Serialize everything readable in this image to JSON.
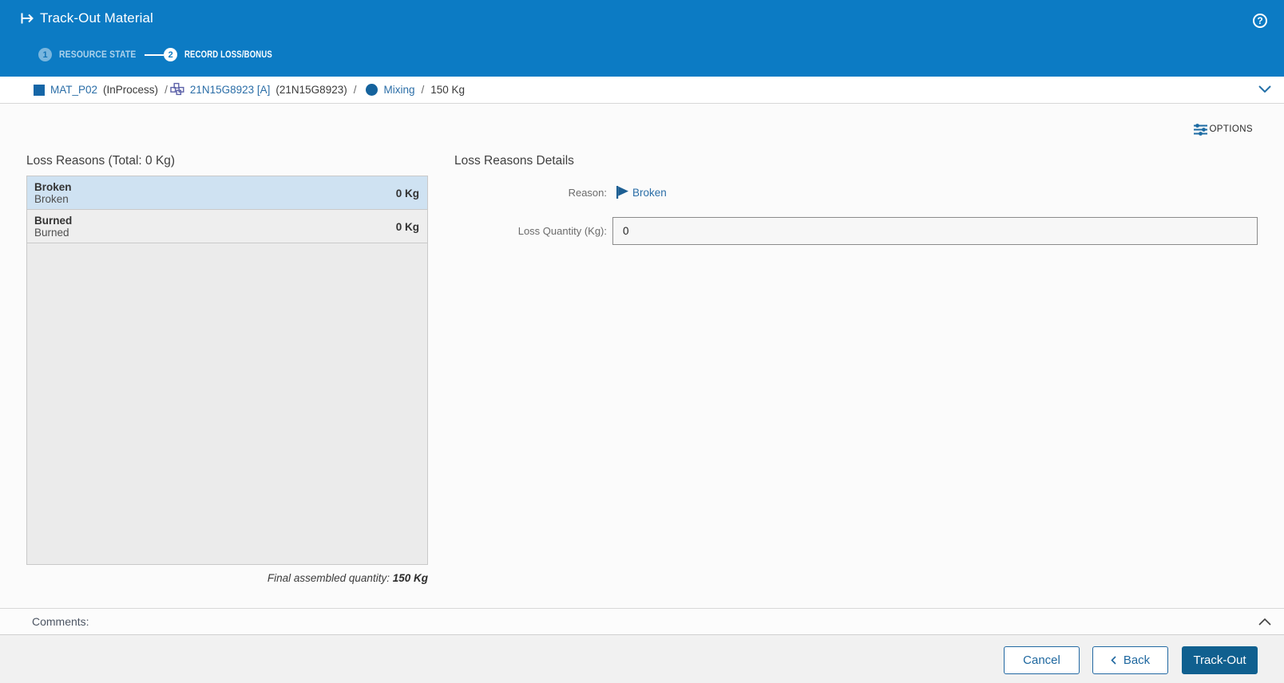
{
  "header": {
    "title": "Track-Out Material",
    "steps": [
      {
        "number": "1",
        "label": "RESOURCE STATE"
      },
      {
        "number": "2",
        "label": "RECORD LOSS/BONUS"
      }
    ],
    "help": "?"
  },
  "breadcrumb": {
    "separator": "/",
    "material": {
      "link": "MAT_P02",
      "status": "(InProcess)"
    },
    "lot": {
      "link": "21N15G8923 [A]",
      "name": "(21N15G8923)"
    },
    "step": {
      "link": "Mixing"
    },
    "quantity": "150 Kg"
  },
  "toolbar": {
    "options_label": "OPTIONS"
  },
  "loss_reasons": {
    "title": "Loss Reasons (Total: 0 Kg)",
    "rows": [
      {
        "name": "Broken",
        "description": "Broken",
        "quantity": "0 Kg"
      },
      {
        "name": "Burned",
        "description": "Burned",
        "quantity": "0 Kg"
      }
    ],
    "final_quantity_label": "Final assembled quantity:",
    "final_quantity_value": "150 Kg"
  },
  "details": {
    "title": "Loss Reasons Details",
    "reason_label": "Reason:",
    "reason_value": "Broken",
    "quantity_label": "Loss Quantity (Kg):",
    "quantity_value": "0"
  },
  "comments": {
    "label": "Comments:"
  },
  "footer": {
    "cancel_label": "Cancel",
    "back_label": "Back",
    "trackout_label": "Track-Out"
  },
  "colors": {
    "header_blue": "#0c7bc4",
    "link_blue": "#2b6ea7",
    "primary_button_blue": "#10608f",
    "selected_row_blue": "#cfe2f2"
  }
}
